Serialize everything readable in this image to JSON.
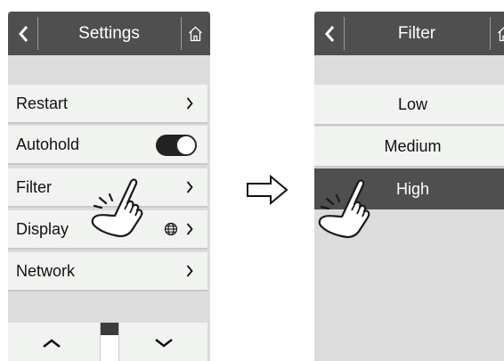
{
  "left_screen": {
    "title": "Settings",
    "back_icon": "chevron-left-icon",
    "home_icon": "home-icon",
    "menu_items": [
      {
        "label": "Restart",
        "trailing": "chevron-right-icon"
      },
      {
        "label": "Autohold",
        "trailing": "toggle",
        "toggle_on": true
      },
      {
        "label": "Filter",
        "trailing": "chevron-right-icon"
      },
      {
        "label": "Display",
        "trailing": "chevron-right-icon",
        "extra_icon": "globe-icon"
      },
      {
        "label": "Network",
        "trailing": "chevron-right-icon"
      }
    ],
    "bottom_bar": {
      "up_icon": "chevron-up-icon",
      "down_icon": "chevron-down-icon"
    }
  },
  "transition_icon": "arrow-right-outline-icon",
  "right_screen": {
    "title": "Filter",
    "back_icon": "chevron-left-icon",
    "home_icon": "home-icon",
    "options": [
      {
        "label": "Low",
        "selected": false
      },
      {
        "label": "Medium",
        "selected": false
      },
      {
        "label": "High",
        "selected": true
      }
    ]
  },
  "pointer_icon": "hand-pointer-icon",
  "colors": {
    "topbar": "#4f4f4f",
    "screen_bg": "#dcdcdc",
    "item_bg": "#f1f3f1",
    "selected_bg": "#4f4f4f"
  }
}
